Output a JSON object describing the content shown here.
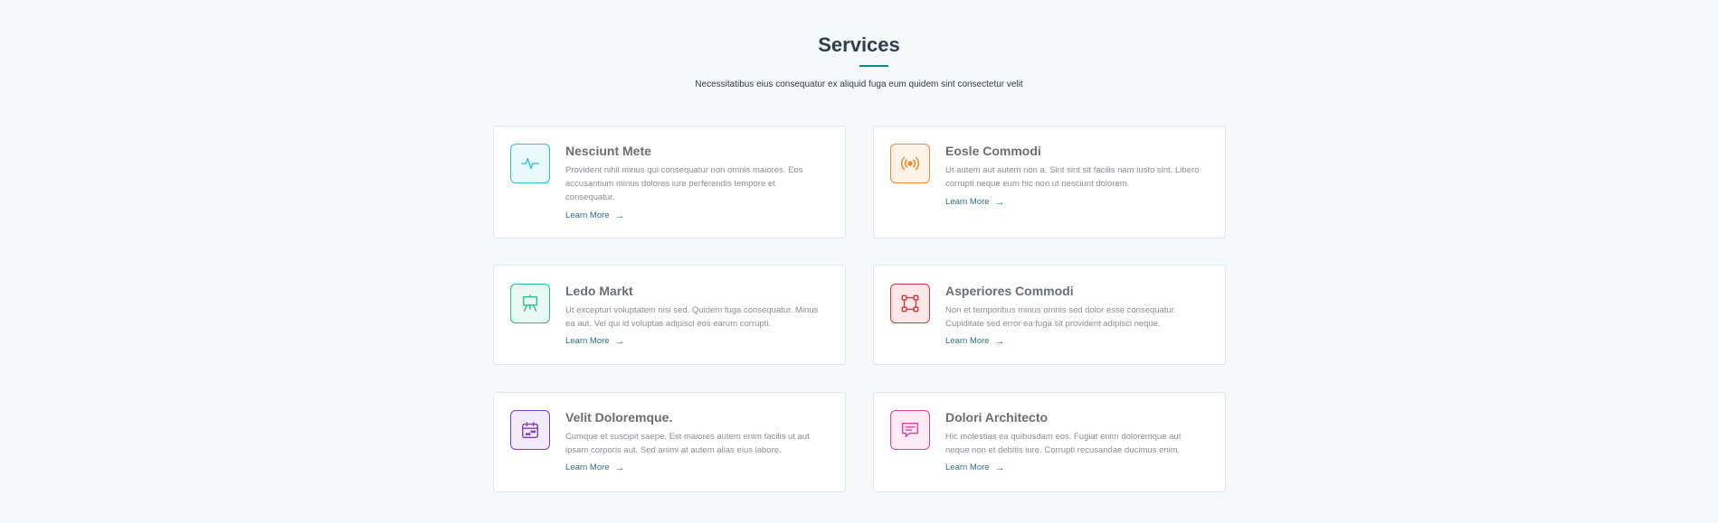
{
  "section": {
    "title": "Services",
    "subtitle": "Necessitatibus eius consequatur ex aliquid fuga eum quidem sint consectetur velit"
  },
  "cards": [
    {
      "title": "Nesciunt Mete",
      "description": "Provident nihil minus qui consequatur non omnis maiores. Eos accusantium minus dolores iure perferendis tempore et consequatur.",
      "link_label": "Learn More",
      "icon": "activity-icon",
      "color": "#2cc1d4",
      "bg": "#eafafc"
    },
    {
      "title": "Eosle Commodi",
      "description": "Ut autem aut autem non a. Sint sint sit facilis nam iusto sint. Libero corrupti neque eum hic non ut nesciunt dolorem.",
      "link_label": "Learn More",
      "icon": "broadcast-icon",
      "color": "#f08a2c",
      "bg": "#fef3e9"
    },
    {
      "title": "Ledo Markt",
      "description": "Ut excepturi voluptatem nisi sed. Quidem fuga consequatur. Minus ea aut. Vel qui id voluptas adipisci eos earum corrupti.",
      "link_label": "Learn More",
      "icon": "easel-icon",
      "color": "#26bf8c",
      "bg": "#e9f9f3"
    },
    {
      "title": "Asperiores Commodi",
      "description": "Non et temporibus minus omnis sed dolor esse consequatur. Cupiditate sed error ea fuga sit provident adipisci neque.",
      "link_label": "Learn More",
      "icon": "bounding-box-icon",
      "color": "#d9343d",
      "bg": "#fbe9ea"
    },
    {
      "title": "Velit Doloremque.",
      "description": "Cumque et suscipit saepe. Est maiores autem enim facilis ut aut ipsam corporis aut. Sed animi at autem alias eius labore.",
      "link_label": "Learn More",
      "icon": "calendar-icon",
      "color": "#7c3bcd",
      "bg": "#f2ebfb"
    },
    {
      "title": "Dolori Architecto",
      "description": "Hic molestias ea quibusdam eos. Fugiat enim doloremque aut neque non et debitis iure. Corrupti recusandae ducimus enim.",
      "link_label": "Learn More",
      "icon": "chat-square-text-icon",
      "color": "#e93d9c",
      "bg": "#fdebf5"
    }
  ]
}
